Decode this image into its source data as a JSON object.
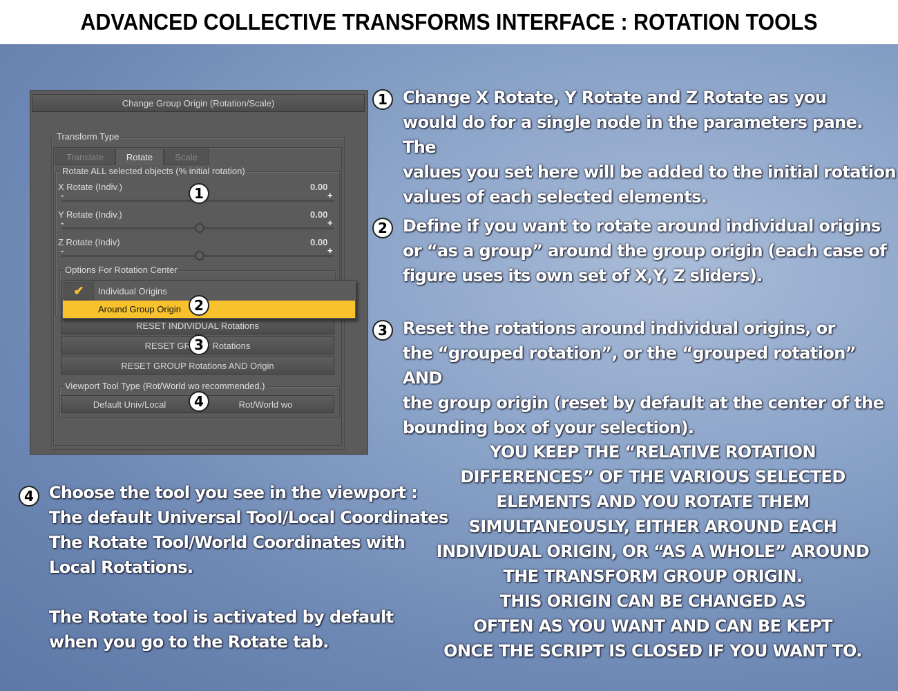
{
  "title": "ADVANCED COLLECTIVE TRANSFORMS INTERFACE : ROTATION TOOLS",
  "panel": {
    "change_origin_button": "Change Group Origin (Rotation/Scale)",
    "transform_type_label": "Transform Type",
    "tabs": [
      {
        "label": "Translate",
        "active": false
      },
      {
        "label": "Rotate",
        "active": true
      },
      {
        "label": "Scale",
        "active": false
      }
    ],
    "rotate_group_label": "Rotate ALL selected objects (% initial rotation)",
    "sliders": [
      {
        "label": "X Rotate (Indiv.)",
        "value": "0.00"
      },
      {
        "label": "Y Rotate (Indiv.)",
        "value": "0.00"
      },
      {
        "label": "Z Rotate (Indiv)",
        "value": "0.00"
      }
    ],
    "minus": "-",
    "plus": "+",
    "rotation_center_label": "Options For Rotation Center",
    "dropdown_options": [
      {
        "label": "Individual Origins",
        "checked": true
      },
      {
        "label": "Around Group Origin",
        "highlighted": true
      }
    ],
    "reset_buttons": [
      "RESET INDIVIDUAL Rotations",
      "RESET GROUP Rotations",
      "RESET GROUP Rotations AND Origin"
    ],
    "viewport_label": "Viewport Tool Type (Rot/World wo recommended.)",
    "viewport_options": [
      "Default Univ/Local",
      "Rot/World wo"
    ],
    "highlight_color": "#f8c22c"
  },
  "badges": [
    "1",
    "2",
    "3",
    "4"
  ],
  "notes": {
    "n1": "Change X Rotate, Y Rotate and Z Rotate as you\nwould do for a single node in the parameters pane. The\nvalues you set here will be added to the initial rotation\nvalues of each selected elements.",
    "n2": "Define if you want to rotate around individual origins\nor “as a group” around the group origin (each case of\nfigure uses its own set of X,Y, Z sliders).",
    "n3": "Reset the rotations around individual origins, or\nthe “grouped rotation”, or the “grouped rotation” AND\nthe group origin (reset by default at the center of the\nbounding box of your selection).",
    "n4": "Choose the tool you see in the viewport :\nThe default Universal Tool/Local Coordinates\nThe Rotate Tool/World Coordinates with\nLocal Rotations.\n\nThe Rotate tool is activated by default\nwhen you go to the Rotate tab.",
    "summary": "YOU KEEP THE “RELATIVE ROTATION\nDIFFERENCES” OF THE VARIOUS SELECTED\nELEMENTS AND YOU ROTATE THEM\nSIMULTANEOUSLY, EITHER AROUND EACH\nINDIVIDUAL ORIGIN, OR “AS A WHOLE” AROUND\nTHE TRANSFORM GROUP ORIGIN.\nTHIS ORIGIN CAN BE CHANGED AS\nOFTEN AS YOU WANT AND CAN BE KEPT\nONCE THE SCRIPT IS CLOSED IF YOU WANT TO."
  }
}
